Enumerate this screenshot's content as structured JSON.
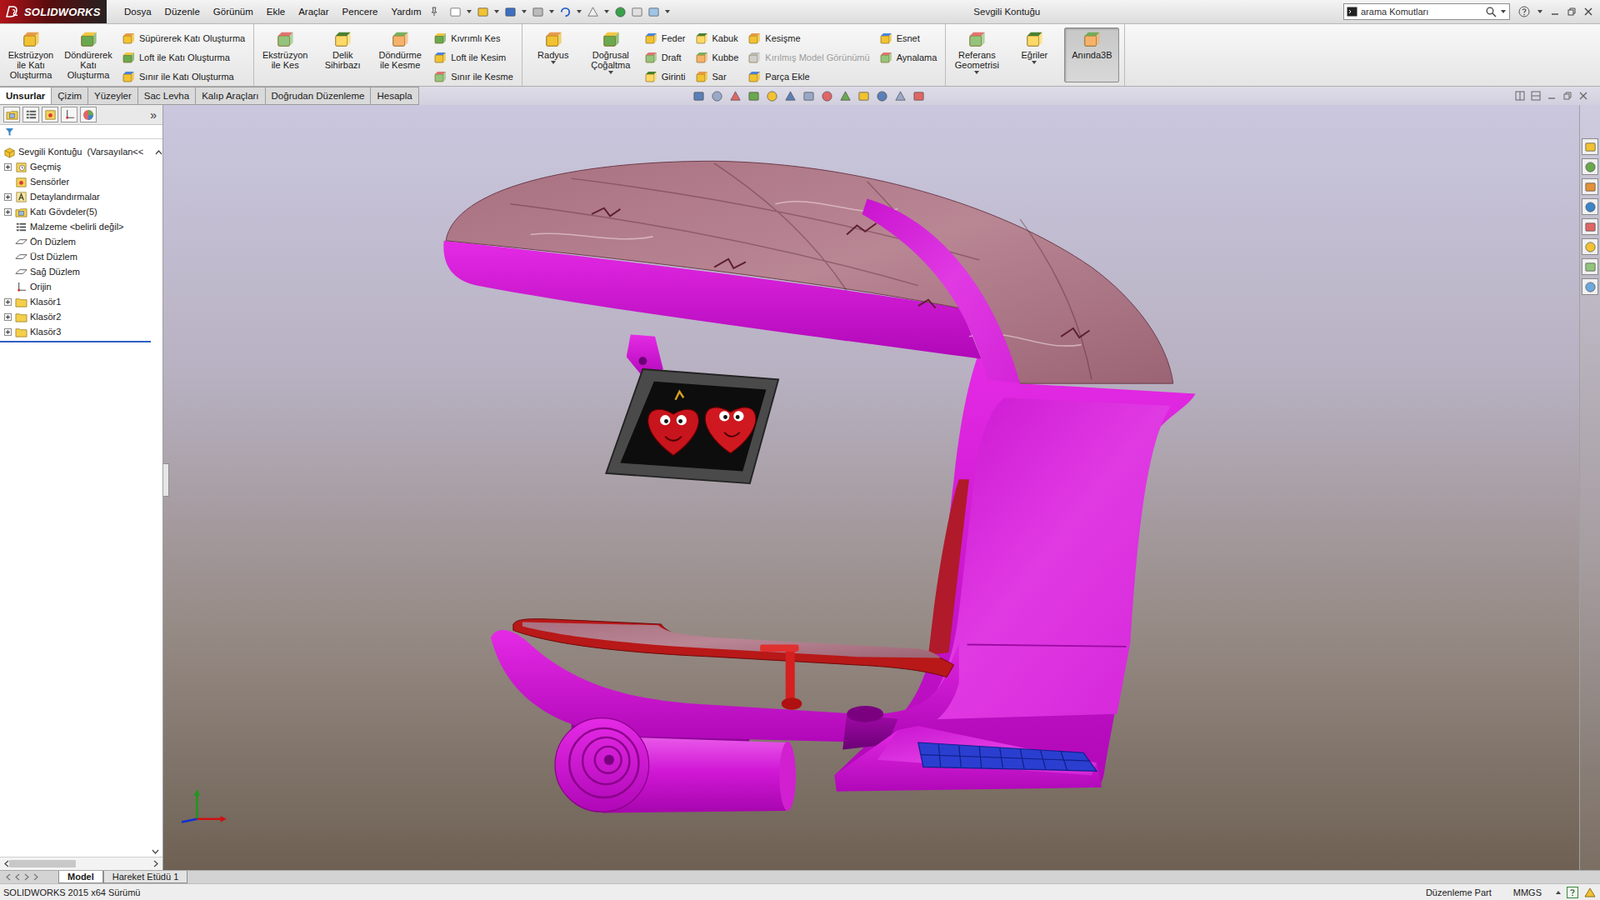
{
  "app": {
    "logo": "SOLIDWORKS",
    "title": "Sevgili Kontuğu"
  },
  "menu": [
    "Dosya",
    "Düzenle",
    "Görünüm",
    "Ekle",
    "Araçlar",
    "Pencere",
    "Yardım"
  ],
  "search": {
    "placeholder": "arama Komutları"
  },
  "ribbon": [
    {
      "big": [
        {
          "label": "Ekstrüzyon ile Katı Oluşturma",
          "dropdown": false,
          "pressed": false
        },
        {
          "label": "Döndürerek Katı Oluşturma",
          "dropdown": false,
          "pressed": false
        }
      ],
      "columns": [
        [
          {
            "label": "Süpürerek Katı Oluşturma",
            "disabled": false
          },
          {
            "label": "Loft ile Katı Oluşturma",
            "disabled": false
          },
          {
            "label": "Sınır ile Katı Oluşturma",
            "disabled": false
          }
        ]
      ]
    },
    {
      "big": [
        {
          "label": "Ekstrüzyon ile Kes",
          "dropdown": false,
          "pressed": false
        },
        {
          "label": "Delik Sihirbazı",
          "dropdown": false,
          "pressed": false
        },
        {
          "label": "Döndürme ile Kesme",
          "dropdown": false,
          "pressed": false
        }
      ],
      "columns": [
        [
          {
            "label": "Kıvrımlı Kes",
            "disabled": false
          },
          {
            "label": "Loft ile Kesim",
            "disabled": false
          },
          {
            "label": "Sınır ile Kesme",
            "disabled": false
          }
        ]
      ]
    },
    {
      "big": [
        {
          "label": "Radyus",
          "dropdown": true,
          "pressed": false
        },
        {
          "label": "Doğrusal Çoğaltma",
          "dropdown": true,
          "pressed": false
        }
      ],
      "columns": [
        [
          {
            "label": "Feder",
            "disabled": false
          },
          {
            "label": "Draft",
            "disabled": false
          },
          {
            "label": "Girinti",
            "disabled": false
          }
        ],
        [
          {
            "label": "Kabuk",
            "disabled": false
          },
          {
            "label": "Kubbe",
            "disabled": false
          },
          {
            "label": "Sar",
            "disabled": false
          }
        ],
        [
          {
            "label": "Kesişme",
            "disabled": false
          },
          {
            "label": "Kırılmış Model Görünümü",
            "disabled": true
          },
          {
            "label": "Parça Ekle",
            "disabled": false
          }
        ],
        [
          {
            "label": "Esnet",
            "disabled": false
          },
          {
            "label": "Aynalama",
            "disabled": false
          }
        ]
      ]
    },
    {
      "big": [
        {
          "label": "Referans Geometrisi",
          "dropdown": true,
          "pressed": false
        },
        {
          "label": "Eğriler",
          "dropdown": true,
          "pressed": false
        },
        {
          "label": "Anında3B",
          "dropdown": false,
          "pressed": true
        }
      ],
      "columns": []
    }
  ],
  "tabs": [
    {
      "label": "Unsurlar",
      "selected": true
    },
    {
      "label": "Çizim",
      "selected": false
    },
    {
      "label": "Yüzeyler",
      "selected": false
    },
    {
      "label": "Sac Levha",
      "selected": false
    },
    {
      "label": "Kalıp Araçları",
      "selected": false
    },
    {
      "label": "Doğrudan Düzenleme",
      "selected": false
    },
    {
      "label": "Hesapla",
      "selected": false
    }
  ],
  "tree": {
    "more": "»",
    "root": {
      "label": "Sevgili Kontuğu  (Varsayılan<<"
    },
    "items": [
      {
        "label": "Geçmiş",
        "kind": "history",
        "expandable": true,
        "expanded": false
      },
      {
        "label": "Sensörler",
        "kind": "sensor",
        "expandable": false,
        "expanded": false
      },
      {
        "label": "Detaylandırmalar",
        "kind": "annotation",
        "expandable": true,
        "expanded": false
      },
      {
        "label": "Katı Gövdeler(5)",
        "kind": "bodies",
        "expandable": true,
        "expanded": false
      },
      {
        "label": "Malzeme <belirli değil>",
        "kind": "material",
        "expandable": false,
        "expanded": false
      },
      {
        "label": "Ön Düzlem",
        "kind": "plane",
        "expandable": false,
        "expanded": false
      },
      {
        "label": "Üst Düzlem",
        "kind": "plane",
        "expandable": false,
        "expanded": false
      },
      {
        "label": "Sağ Düzlem",
        "kind": "plane",
        "expandable": false,
        "expanded": false
      },
      {
        "label": "Orijin",
        "kind": "origin",
        "expandable": false,
        "expanded": false
      },
      {
        "label": "Klasör1",
        "kind": "folder",
        "expandable": true,
        "expanded": false
      },
      {
        "label": "Klasör2",
        "kind": "folder",
        "expandable": true,
        "expanded": false
      },
      {
        "label": "Klasör3",
        "kind": "folder",
        "expandable": true,
        "expanded": false
      }
    ]
  },
  "bottomTabs": [
    {
      "label": "Model",
      "selected": true
    },
    {
      "label": "Hareket Etüdü 1",
      "selected": false
    }
  ],
  "status": {
    "version": "SOLIDWORKS 2015 x64 Sürümü",
    "mode": "Düzenleme Part",
    "units": "MMGS"
  }
}
